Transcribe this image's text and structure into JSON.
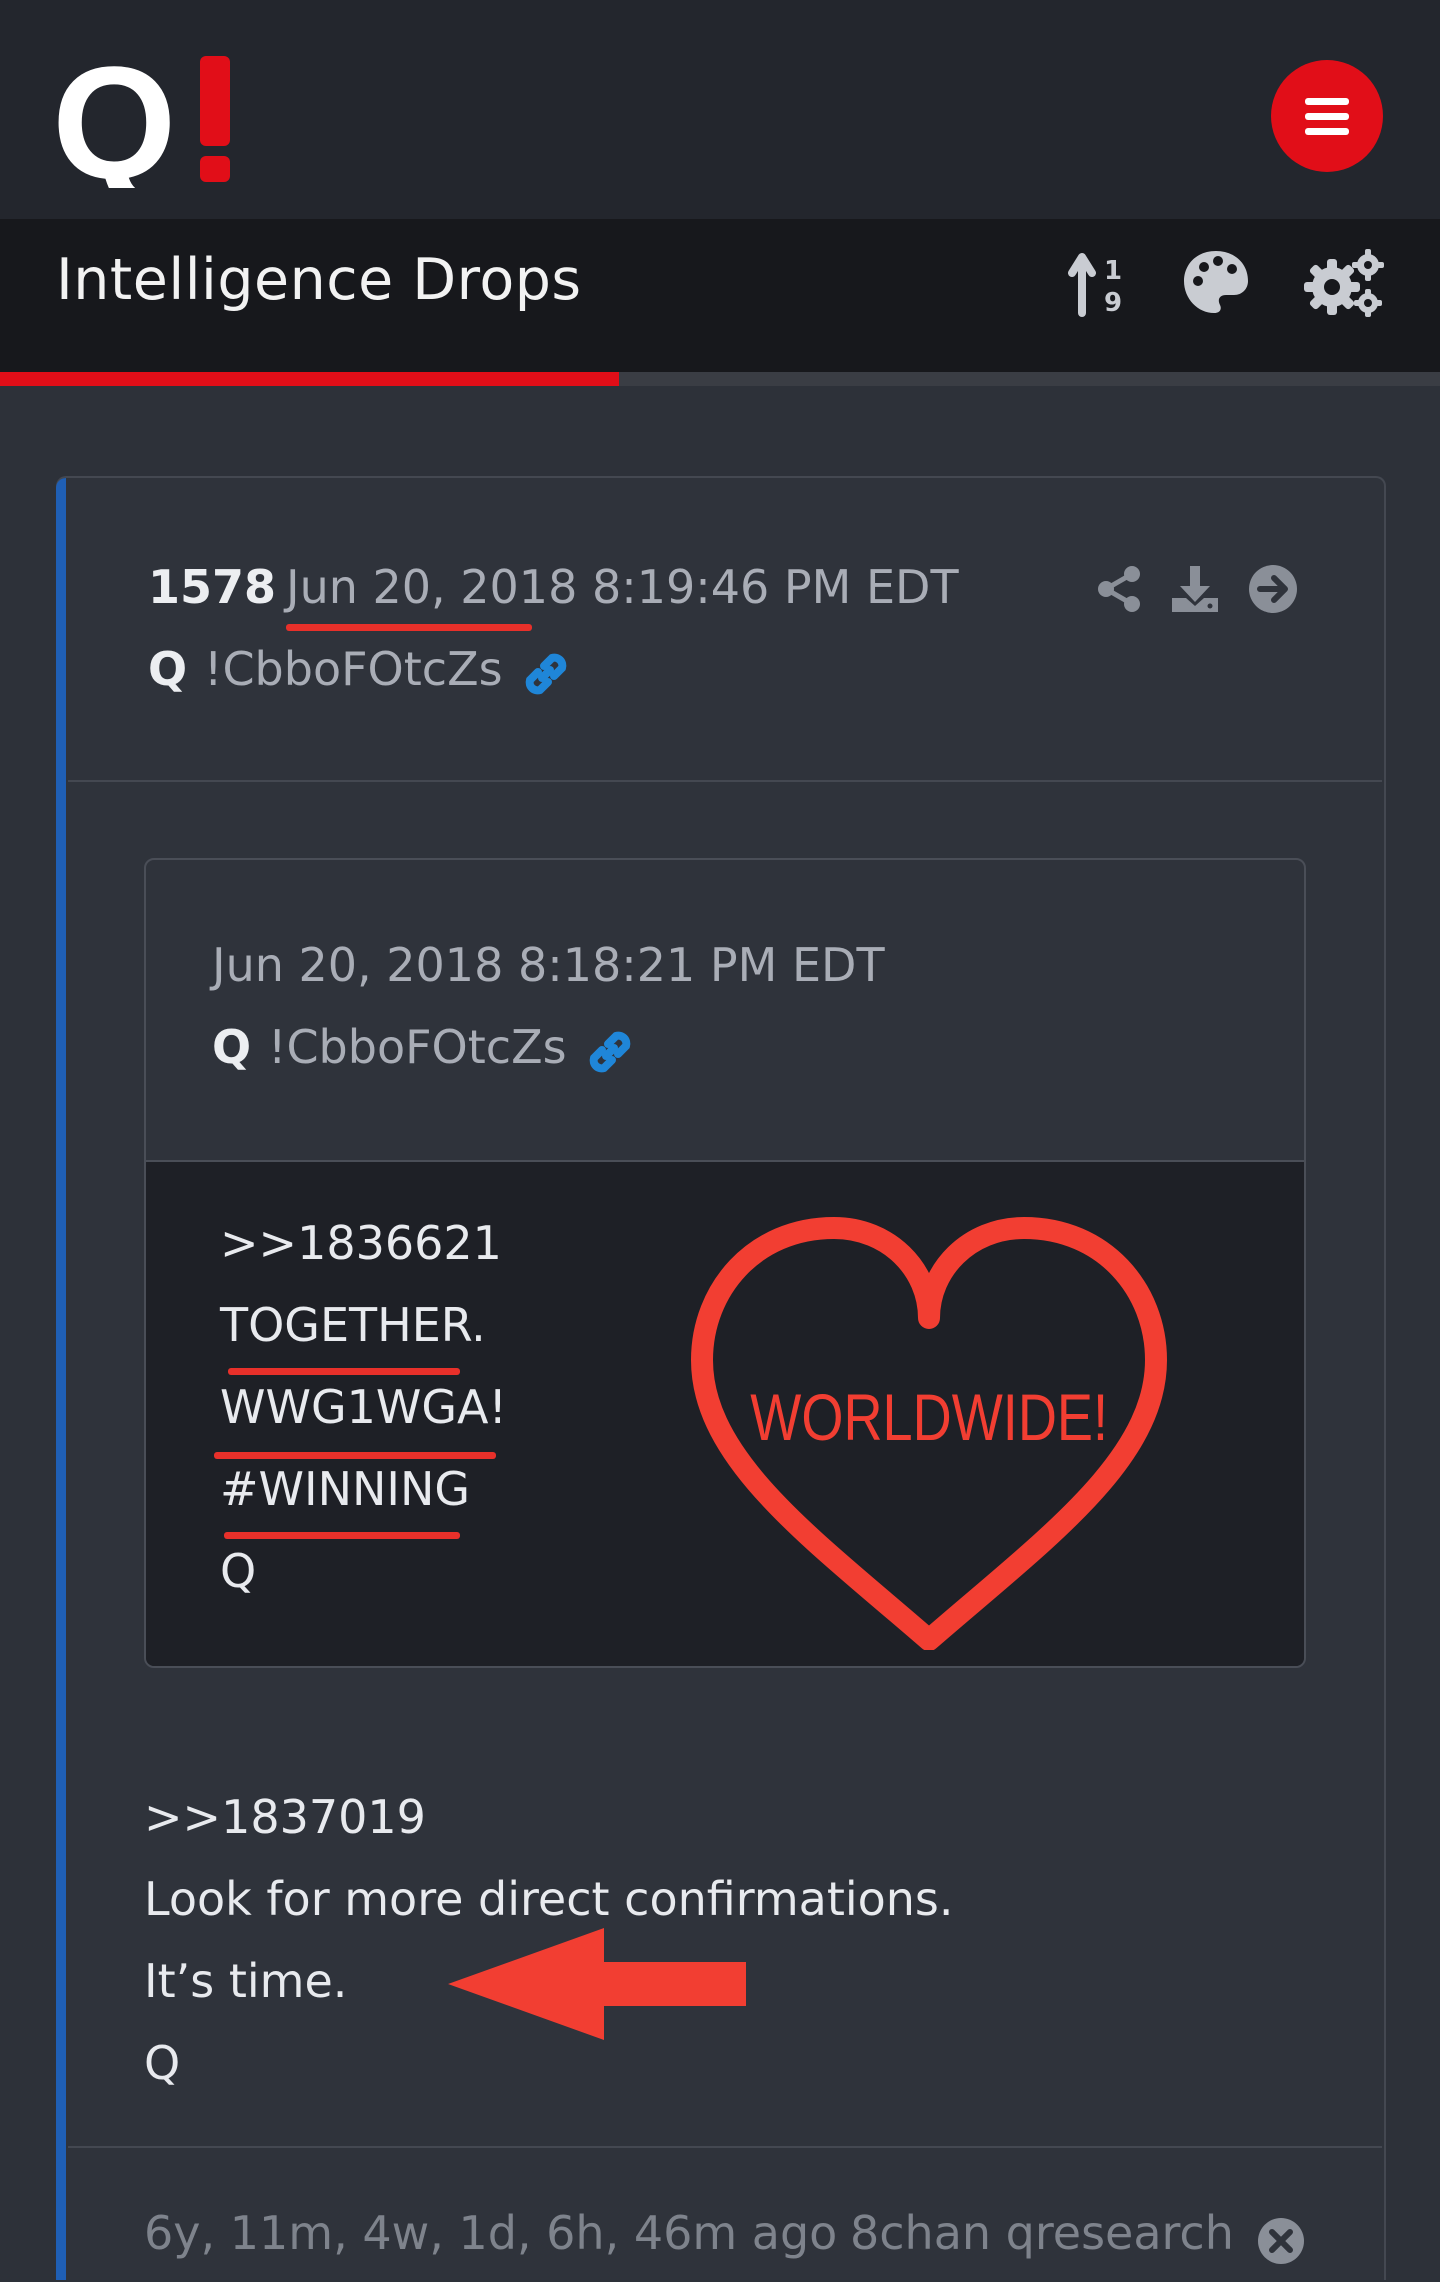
{
  "header": {
    "logo_text": "Q!",
    "menu_icon": "hamburger-menu-icon"
  },
  "titlebar": {
    "title": "Intelligence Drops",
    "icons": [
      "sort-numeric-icon",
      "palette-icon",
      "settings-gears-icon"
    ]
  },
  "progress": {
    "fraction": 0.43
  },
  "post": {
    "number": "1578",
    "date": "Jun 20, 2018 8:19:46 PM EDT",
    "author": "Q",
    "tripcode": "!CbboFOtcZs",
    "header_icons": [
      "share-icon",
      "download-icon",
      "arrow-circle-right-icon"
    ],
    "quote": {
      "date": "Jun 20, 2018 8:18:21 PM EDT",
      "author": "Q",
      "tripcode": "!CbboFOtcZs",
      "lines": [
        ">>1836621",
        "TOGETHER.",
        "WWG1WGA!",
        "#WINNING",
        "Q"
      ],
      "image_text": "WORLDWIDE!"
    },
    "message": [
      ">>1837019",
      "Look for more direct confirmations.",
      "It’s time.",
      "Q"
    ],
    "footer": {
      "age": "6y, 11m, 4w, 1d, 6h, 46m ago",
      "source": "8chan qresearch"
    }
  },
  "colors": {
    "accent_red": "#e10e18",
    "annotation_red": "#e8302a",
    "link_blue": "#1f86d8",
    "left_bar_blue": "#1f5fb5"
  }
}
